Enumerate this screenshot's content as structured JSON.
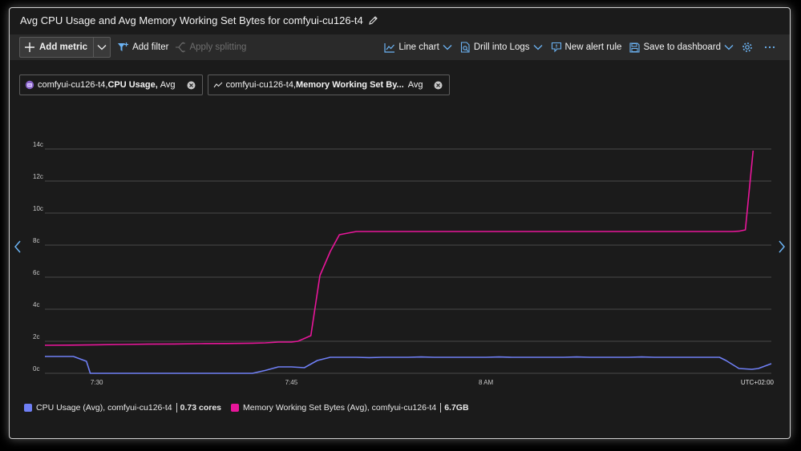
{
  "title": "Avg CPU Usage and Avg Memory Working Set Bytes for comfyui-cu126-t4",
  "toolbar": {
    "add_metric": "Add metric",
    "add_filter": "Add filter",
    "apply_splitting": "Apply splitting",
    "line_chart": "Line chart",
    "drill_into_logs": "Drill into Logs",
    "new_alert_rule": "New alert rule",
    "save_to_dashboard": "Save to dashboard"
  },
  "pills": [
    {
      "resource": "comfyui-cu126-t4,",
      "metric": "CPU Usage,",
      "agg": "Avg"
    },
    {
      "resource": "comfyui-cu126-t4,",
      "metric": "Memory Working Set By...",
      "agg": "Avg"
    }
  ],
  "legend": [
    {
      "label": "CPU Usage (Avg), comfyui-cu126-t4",
      "value": "0.73 cores",
      "color": "#6f7ff5"
    },
    {
      "label": "Memory Working Set Bytes (Avg), comfyui-cu126-t4",
      "value": "6.7GB",
      "color": "#e8169a"
    }
  ],
  "chart_data": {
    "type": "line",
    "y_tick_labels": [
      "0c",
      "2c",
      "4c",
      "6c",
      "8c",
      "10c",
      "12c",
      "14c"
    ],
    "y_ticks": [
      0,
      2,
      4,
      6,
      8,
      10,
      12,
      14
    ],
    "ylim": [
      0,
      14
    ],
    "x_tick_labels": [
      "7:30",
      "7:45",
      "8 AM"
    ],
    "x_tick_positions": [
      30,
      45,
      60
    ],
    "xlim": [
      26,
      82
    ],
    "timezone_label": "UTC+02:00",
    "grid": true,
    "series": [
      {
        "name": "CPU Usage (Avg), comfyui-cu126-t4",
        "color": "#6f7ff5",
        "x": [
          26,
          26.5,
          27.5,
          28.2,
          29.2,
          29.5,
          30,
          31,
          32.4,
          33,
          34,
          35,
          36,
          37,
          38,
          39,
          40,
          41,
          42,
          43,
          44,
          45,
          46,
          47,
          48,
          49,
          50,
          51,
          52,
          53,
          54,
          55,
          56,
          57,
          58,
          59,
          60,
          61,
          62,
          63,
          64,
          65,
          66,
          67,
          68,
          69,
          70,
          71,
          72,
          73,
          74,
          75,
          76,
          77,
          78,
          78.5,
          79.5,
          80.5,
          81,
          82
        ],
        "values": [
          1.05,
          1.05,
          1.05,
          1.05,
          0.75,
          0.0,
          0.0,
          0.0,
          0.0,
          0.0,
          0.0,
          0.0,
          0.0,
          0.0,
          0.0,
          0.0,
          0.0,
          0.0,
          0.0,
          0.18,
          0.4,
          0.4,
          0.35,
          0.8,
          1.0,
          1.0,
          1.0,
          0.98,
          1.0,
          1.0,
          1.0,
          1.02,
          1.0,
          1.0,
          1.0,
          1.0,
          1.0,
          1.02,
          1.0,
          1.0,
          1.0,
          1.0,
          1.0,
          1.02,
          1.0,
          1.0,
          1.0,
          1.0,
          1.02,
          1.0,
          1.0,
          1.0,
          1.0,
          1.0,
          1.0,
          0.8,
          0.3,
          0.25,
          0.3,
          0.6
        ]
      },
      {
        "name": "Memory Working Set Bytes (Avg), comfyui-cu126-t4",
        "color": "#e8169a",
        "x": [
          26,
          28,
          30,
          32,
          34,
          36,
          38,
          40,
          42,
          43,
          44,
          45,
          45.5,
          46.5,
          47.2,
          48,
          48.7,
          50,
          55,
          60,
          65,
          70,
          75,
          77,
          79,
          79.5,
          80,
          80.6
        ],
        "values": [
          1.75,
          1.76,
          1.78,
          1.8,
          1.82,
          1.83,
          1.85,
          1.86,
          1.88,
          1.9,
          1.95,
          1.95,
          2.0,
          2.35,
          6.1,
          7.6,
          8.65,
          8.85,
          8.85,
          8.85,
          8.85,
          8.85,
          8.85,
          8.85,
          8.85,
          8.87,
          8.95,
          13.9
        ]
      }
    ]
  }
}
